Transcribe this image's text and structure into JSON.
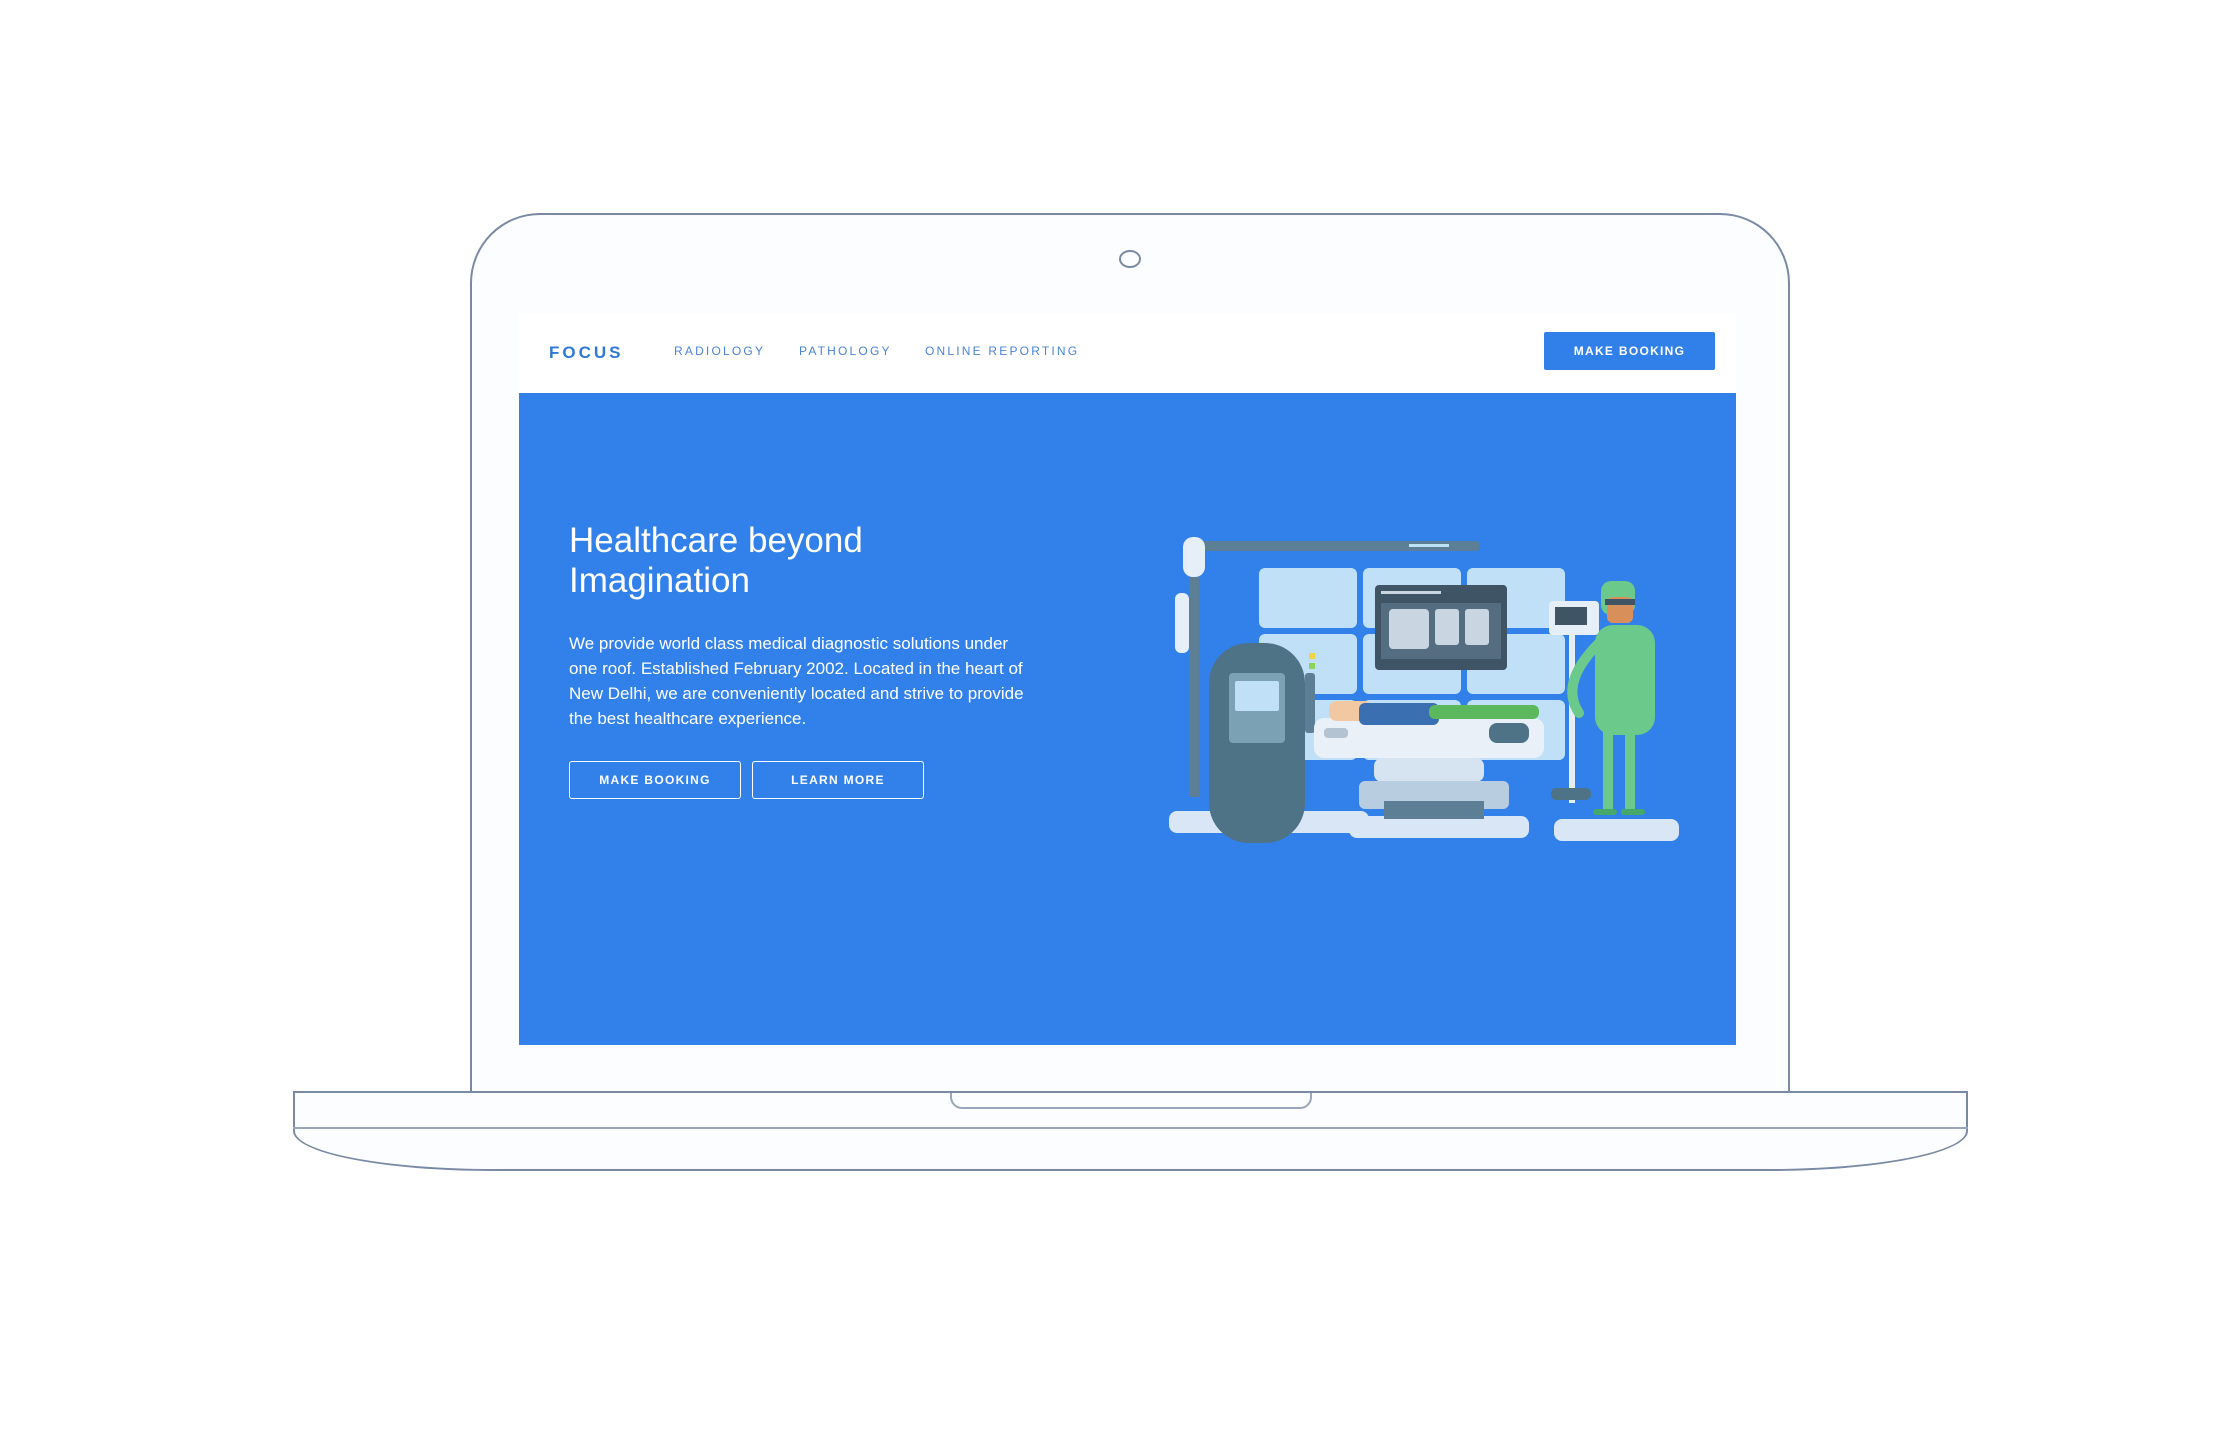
{
  "brand": {
    "logo": "FOCUS"
  },
  "nav": {
    "links": [
      "RADIOLOGY",
      "PATHOLOGY",
      "ONLINE REPORTING"
    ],
    "cta": "MAKE BOOKING"
  },
  "hero": {
    "title": "Healthcare beyond Imagination",
    "description": "We provide world class medical diagnostic solutions under one roof. Established February 2002. Located in the heart of New Delhi, we are conveniently located and strive to provide the best healthcare experience.",
    "primary_button": "MAKE BOOKING",
    "secondary_button": "LEARN MORE",
    "illustration": "mri-scanner-with-doctor-and-patient-illustration"
  },
  "colors": {
    "accent": "#3281eb",
    "nav_text": "#4a84d6",
    "frame": "#7a8aa5"
  }
}
